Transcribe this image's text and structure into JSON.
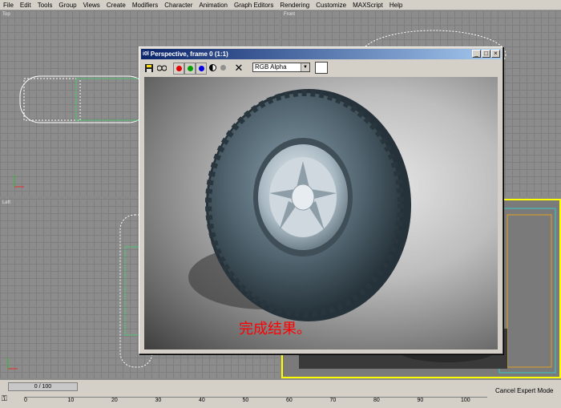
{
  "menu": [
    "File",
    "Edit",
    "Tools",
    "Group",
    "Views",
    "Create",
    "Modifiers",
    "Character",
    "Animation",
    "Graph Editors",
    "Rendering",
    "Customize",
    "MAXScript",
    "Help"
  ],
  "viewports": {
    "top": "Top",
    "front": "Front",
    "left": "Left",
    "perspective": ""
  },
  "render_window": {
    "title": "Perspective, frame 0 (1:1)",
    "channel": "RGB Alpha",
    "caption": "完成结果。",
    "min": "_",
    "max": "□",
    "close": "×"
  },
  "status": {
    "frame_counter": "0 / 100",
    "cancel_expert": "Cancel Expert Mode",
    "ruler_ticks": [
      "0",
      "10",
      "20",
      "30",
      "40",
      "50",
      "60",
      "70",
      "80",
      "90",
      "100"
    ]
  },
  "colors": {
    "title_active": "#0a246a",
    "caption": "#ff0000"
  }
}
